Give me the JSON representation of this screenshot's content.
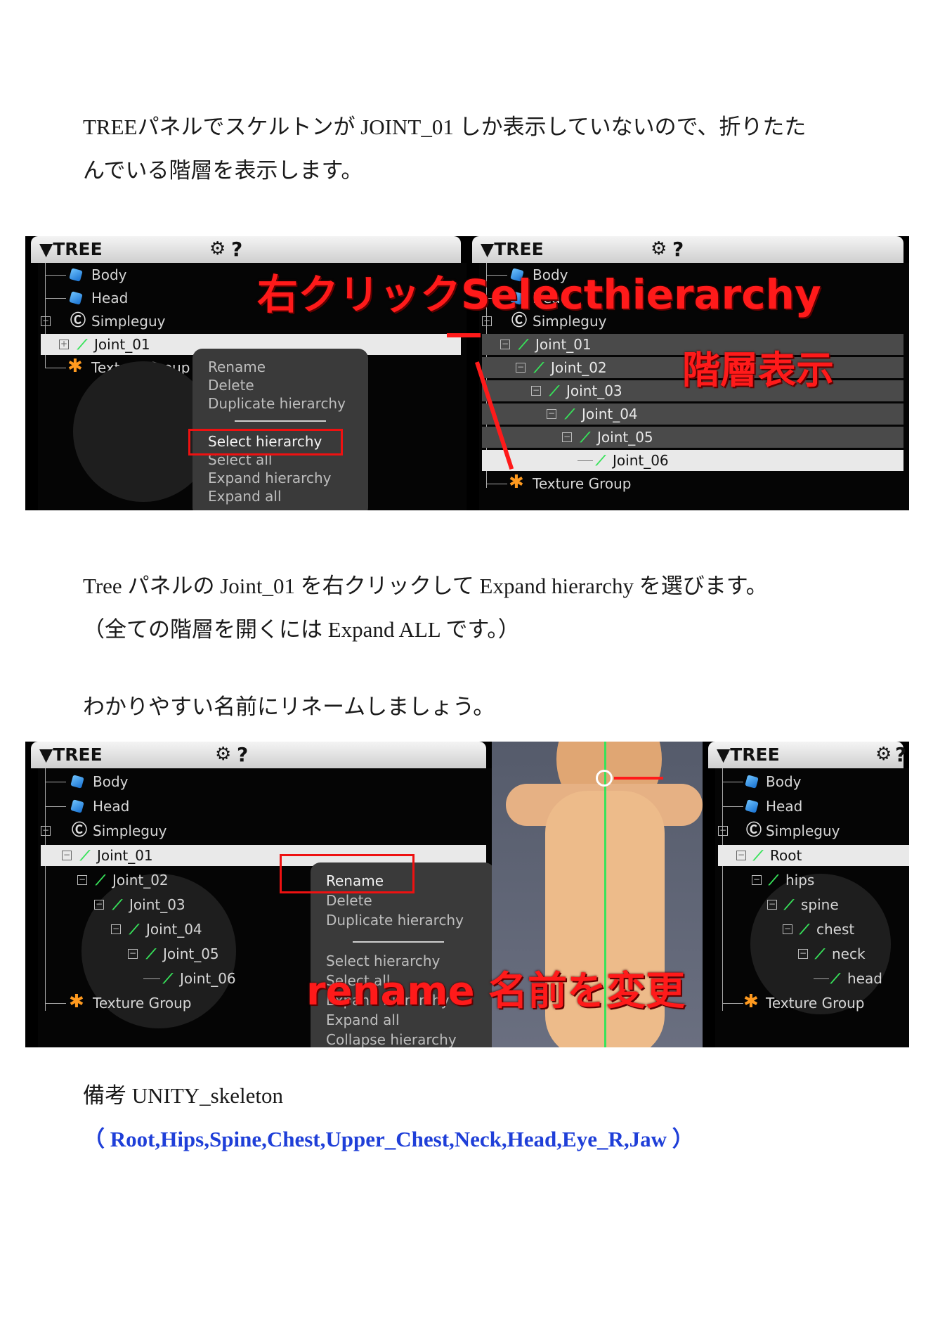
{
  "paragraph1": [
    "TREEパネルでスケルトンが JOINT_01 しか表示していないので、折りたた",
    "んでいる階層を表示します。"
  ],
  "paragraph2": [
    "Tree パネルの Joint_01 を右クリックして Expand hierarchy を選びます。",
    "（全ての階層を開くには Expand ALL です。）"
  ],
  "paragraph3": "わかりやすい名前にリネームしましょう。",
  "note_label": "備考 UNITY_skeleton",
  "note_list": "（ Root,Hips,Spine,Chest,Upper_Chest,Neck,Head,Eye_R,Jaw ）",
  "panel": {
    "title": "▼TREE",
    "gear": "⚙",
    "help": "?"
  },
  "shot1": {
    "left_tree": [
      "Body",
      "Head",
      "Simpleguy",
      "Joint_01",
      "Texture Group"
    ],
    "menu": [
      "Rename",
      "Delete",
      "Duplicate hierarchy",
      "Select hierarchy",
      "Select all",
      "Expand hierarchy",
      "Expand all"
    ],
    "right_tree": [
      "Body",
      "Head",
      "Simpleguy",
      "Joint_01",
      "Joint_02",
      "Joint_03",
      "Joint_04",
      "Joint_05",
      "Joint_06",
      "Texture Group"
    ],
    "annotation_top": "右クリックSelecthierarchy",
    "annotation_right": "階層表示"
  },
  "shot2": {
    "left_tree": [
      "Body",
      "Head",
      "Simpleguy",
      "Joint_01",
      "Joint_02",
      "Joint_03",
      "Joint_04",
      "Joint_05",
      "Joint_06",
      "Texture Group"
    ],
    "menu": [
      "Rename",
      "Delete",
      "Duplicate hierarchy",
      "Select hierarchy",
      "Select all",
      "Expand hierarchy",
      "Expand all",
      "Collapse hierarchy"
    ],
    "right_tree": [
      "Body",
      "Head",
      "Simpleguy",
      "Root",
      "hips",
      "spine",
      "chest",
      "neck",
      "head",
      "Texture Group"
    ],
    "annotation": "rename 名前を変更"
  },
  "colors": {
    "annotation_red": "#ff1a1a",
    "bone_green": "#37e35a",
    "note_blue": "#1f3fd8"
  }
}
